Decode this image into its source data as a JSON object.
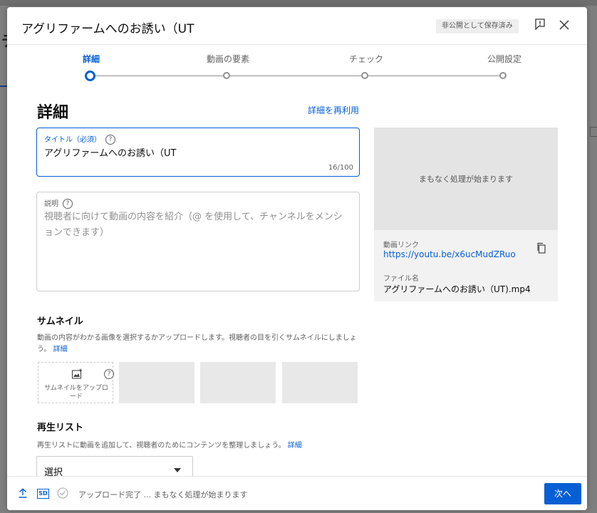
{
  "background": {
    "left_char": "チ"
  },
  "dialog": {
    "title": "アグリファームへのお誘い（UT",
    "saved_badge": "非公開として保存済み",
    "feedback_icon": "feedback-icon",
    "close_icon": "close-icon"
  },
  "stepper": {
    "steps": [
      {
        "label": "詳細",
        "active": true
      },
      {
        "label": "動画の要素",
        "active": false
      },
      {
        "label": "チェック",
        "active": false
      },
      {
        "label": "公開設定",
        "active": false
      }
    ]
  },
  "details": {
    "section_title": "詳細",
    "reuse_link": "詳細を再利用",
    "title_field": {
      "label": "タイトル（必須）",
      "value": "アグリファームへのお誘い（UT",
      "count": "16/100"
    },
    "description_field": {
      "label": "説明",
      "placeholder": "視聴者に向けて動画の内容を紹介（@ を使用して、チャンネルをメンションできます）"
    }
  },
  "preview": {
    "processing": "まもなく処理が始まります",
    "link_label": "動画リンク",
    "link": "https://youtu.be/x6ucMudZRuo",
    "file_label": "ファイル名",
    "file_name": "アグリファームへのお誘い（UT).mp4"
  },
  "thumbnail": {
    "title": "サムネイル",
    "desc": "動画の内容がわかる画像を選択するかアップロードします。視聴者の目を引くサムネイルにしましょう。",
    "desc_link": "詳細",
    "upload_label": "サムネイルをアップロード"
  },
  "playlist": {
    "title": "再生リスト",
    "desc": "再生リストに動画を追加して、視聴者のためにコンテンツを整理しましょう。",
    "desc_link": "詳細",
    "select_value": "選択"
  },
  "footer": {
    "sd_badge": "SD",
    "status": "アップロード完了 ... まもなく処理が始まります",
    "next_label": "次へ"
  },
  "colors": {
    "accent": "#065fd4",
    "text": "#0d0d0d",
    "muted": "#606060"
  }
}
